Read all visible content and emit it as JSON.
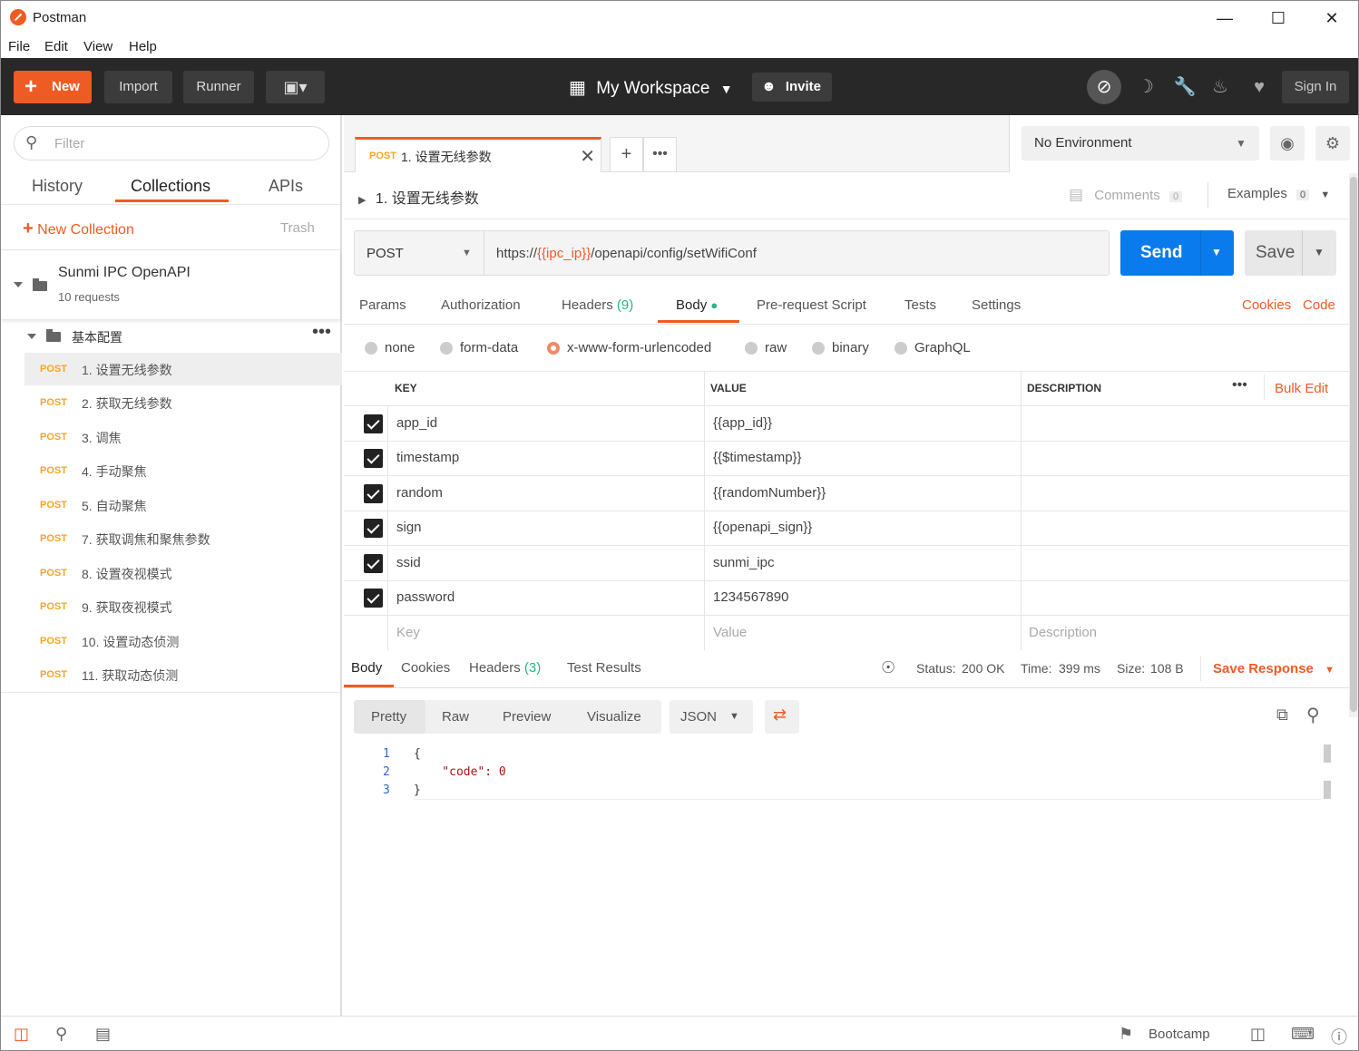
{
  "window": {
    "title": "Postman"
  },
  "menu": [
    "File",
    "Edit",
    "View",
    "Help"
  ],
  "header": {
    "new": "New",
    "import": "Import",
    "runner": "Runner",
    "workspace": "My Workspace",
    "invite": "Invite",
    "signin": "Sign In"
  },
  "sidebar": {
    "filter_placeholder": "Filter",
    "tabs": [
      "History",
      "Collections",
      "APIs"
    ],
    "new_collection": "New Collection",
    "trash": "Trash",
    "collection": {
      "name": "Sunmi IPC OpenAPI",
      "count": "10 requests"
    },
    "folder": "基本配置",
    "requests": [
      {
        "method": "POST",
        "name": "1. 设置无线参数"
      },
      {
        "method": "POST",
        "name": "2. 获取无线参数"
      },
      {
        "method": "POST",
        "name": "3. 调焦"
      },
      {
        "method": "POST",
        "name": "4. 手动聚焦"
      },
      {
        "method": "POST",
        "name": "5. 自动聚焦"
      },
      {
        "method": "POST",
        "name": "7. 获取调焦和聚焦参数"
      },
      {
        "method": "POST",
        "name": "8. 设置夜视模式"
      },
      {
        "method": "POST",
        "name": "9. 获取夜视模式"
      },
      {
        "method": "POST",
        "name": "10. 设置动态侦测"
      },
      {
        "method": "POST",
        "name": "11. 获取动态侦测"
      }
    ]
  },
  "tab": {
    "method": "POST",
    "name": "1. 设置无线参数"
  },
  "env": {
    "selected": "No Environment"
  },
  "request": {
    "name": "1. 设置无线参数",
    "comments": "Comments",
    "comments_count": "0",
    "examples": "Examples",
    "examples_count": "0",
    "method": "POST",
    "url_prefix": "https://",
    "url_var": "{{ipc_ip}}",
    "url_suffix": "/openapi/config/setWifiConf",
    "send": "Send",
    "save": "Save",
    "tabs": {
      "params": "Params",
      "auth": "Authorization",
      "headers": "Headers",
      "headers_count": "(9)",
      "body": "Body",
      "prerequest": "Pre-request Script",
      "tests": "Tests",
      "settings": "Settings",
      "cookies": "Cookies",
      "code": "Code"
    },
    "body_types": [
      "none",
      "form-data",
      "x-www-form-urlencoded",
      "raw",
      "binary",
      "GraphQL"
    ],
    "columns": {
      "key": "KEY",
      "value": "VALUE",
      "description": "DESCRIPTION",
      "bulk_edit": "Bulk Edit"
    },
    "rows": [
      {
        "key": "app_id",
        "value": "{{app_id}}"
      },
      {
        "key": "timestamp",
        "value": "{{$timestamp}}"
      },
      {
        "key": "random",
        "value": "{{randomNumber}}"
      },
      {
        "key": "sign",
        "value": "{{openapi_sign}}"
      },
      {
        "key": "ssid",
        "value": "sunmi_ipc"
      },
      {
        "key": "password",
        "value": "1234567890"
      }
    ],
    "placeholders": {
      "key": "Key",
      "value": "Value",
      "description": "Description"
    }
  },
  "response": {
    "tabs": {
      "body": "Body",
      "cookies": "Cookies",
      "headers": "Headers",
      "headers_count": "(3)",
      "tests": "Test Results"
    },
    "status_label": "Status:",
    "status": "200 OK",
    "time_label": "Time:",
    "time": "399 ms",
    "size_label": "Size:",
    "size": "108 B",
    "save": "Save Response",
    "formats": [
      "Pretty",
      "Raw",
      "Preview",
      "Visualize"
    ],
    "lang": "JSON",
    "lines": [
      "1",
      "2",
      "3"
    ],
    "code": [
      "{",
      "    \"code\": 0",
      "}"
    ]
  },
  "footer": {
    "bootcamp": "Bootcamp"
  },
  "colors": {
    "accent": "#ef5b25",
    "send": "#097bed",
    "ok": "#26b47f",
    "method": "#f5a623"
  }
}
